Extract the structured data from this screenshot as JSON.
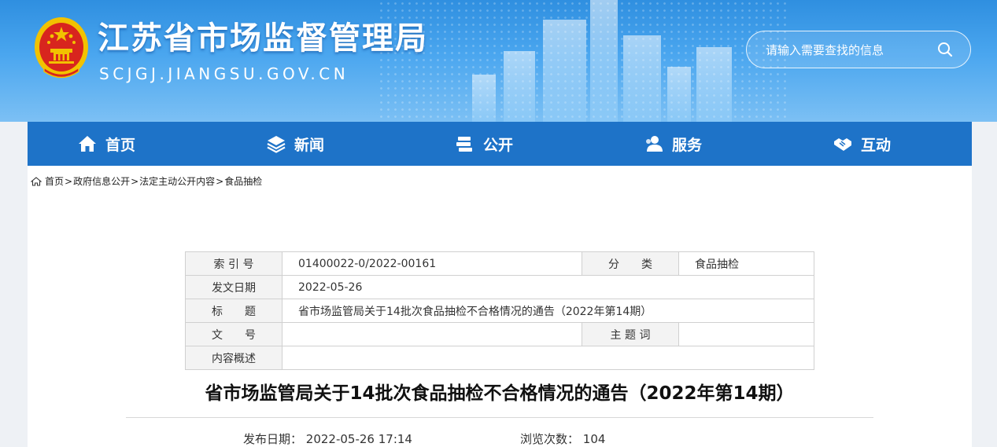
{
  "header": {
    "title": "江苏省市场监督管理局",
    "domain": "SCJGJ.JIANGSU.GOV.CN",
    "search_placeholder": "请输入需要查找的信息"
  },
  "nav": {
    "items": [
      {
        "label": "首页",
        "icon": "home-icon"
      },
      {
        "label": "新闻",
        "icon": "layers-icon"
      },
      {
        "label": "公开",
        "icon": "books-icon"
      },
      {
        "label": "服务",
        "icon": "people-icon"
      },
      {
        "label": "互动",
        "icon": "handshake-icon"
      }
    ]
  },
  "breadcrumb": [
    "首页",
    "政府信息公开",
    "法定主动公开内容",
    "食品抽检"
  ],
  "meta_table": {
    "index_label": "索 引 号",
    "index_value": "01400022-0/2022-00161",
    "category_label": "分　　类",
    "category_value": "食品抽检",
    "date_label": "发文日期",
    "date_value": "2022-05-26",
    "title_label": "标　　题",
    "title_value": "省市场监管局关于14批次食品抽检不合格情况的通告（2022年第14期）",
    "docno_label": "文　　号",
    "docno_value": "",
    "keyword_label": "主 题 词",
    "keyword_value": "",
    "summary_label": "内容概述",
    "summary_value": ""
  },
  "article": {
    "title": "省市场监管局关于14批次食品抽检不合格情况的通告（2022年第14期）",
    "publish_label": "发布日期：",
    "publish_value": "2022-05-26 17:14",
    "views_label": "浏览次数：",
    "views_value": "104"
  },
  "colors": {
    "nav_bg": "#1e73c8",
    "banner_top": "#2f8fe0",
    "emblem_red": "#d8251e",
    "emblem_gold": "#f2c200"
  }
}
